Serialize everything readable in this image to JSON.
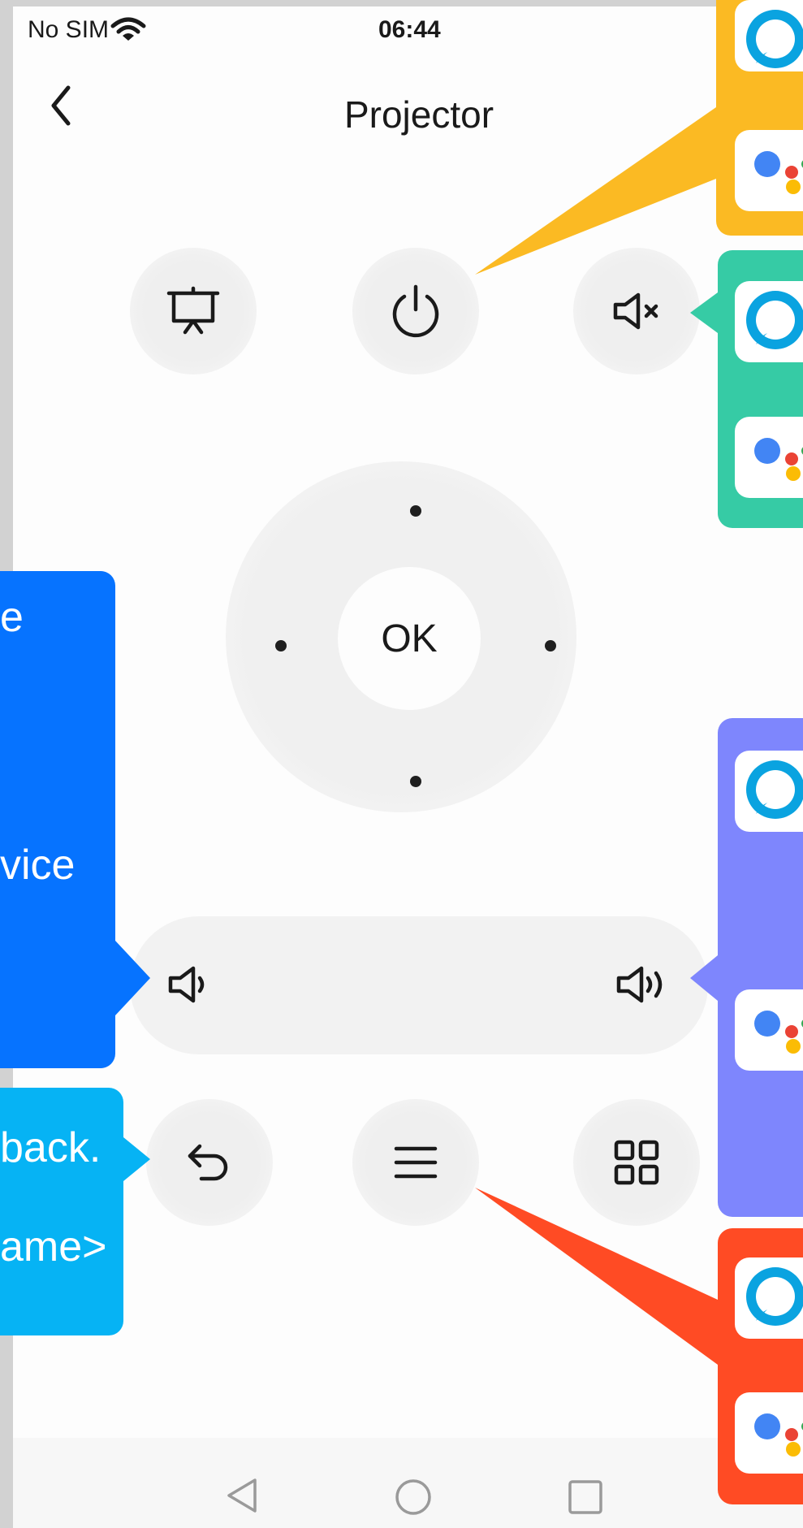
{
  "status_bar": {
    "carrier": "No SIM",
    "time": "06:44"
  },
  "header": {
    "title": "Projector"
  },
  "remote": {
    "ok_label": "OK"
  },
  "callouts": {
    "blue": {
      "line1": "e",
      "line2": "vice"
    },
    "cyan": {
      "line1": "back.",
      "line2": "ame>"
    }
  },
  "colors": {
    "yellow": "#FBBA23",
    "green": "#36CBA5",
    "purple": "#7E86FD",
    "red": "#FF4B24",
    "blue": "#0673FF",
    "cyan": "#06B3F4"
  },
  "icons": [
    "back-chevron-icon",
    "presentation-icon",
    "power-icon",
    "mute-icon",
    "volume-down-icon",
    "volume-up-icon",
    "undo-icon",
    "menu-icon",
    "grid-icon",
    "alexa-icon",
    "google-assistant-icon"
  ]
}
